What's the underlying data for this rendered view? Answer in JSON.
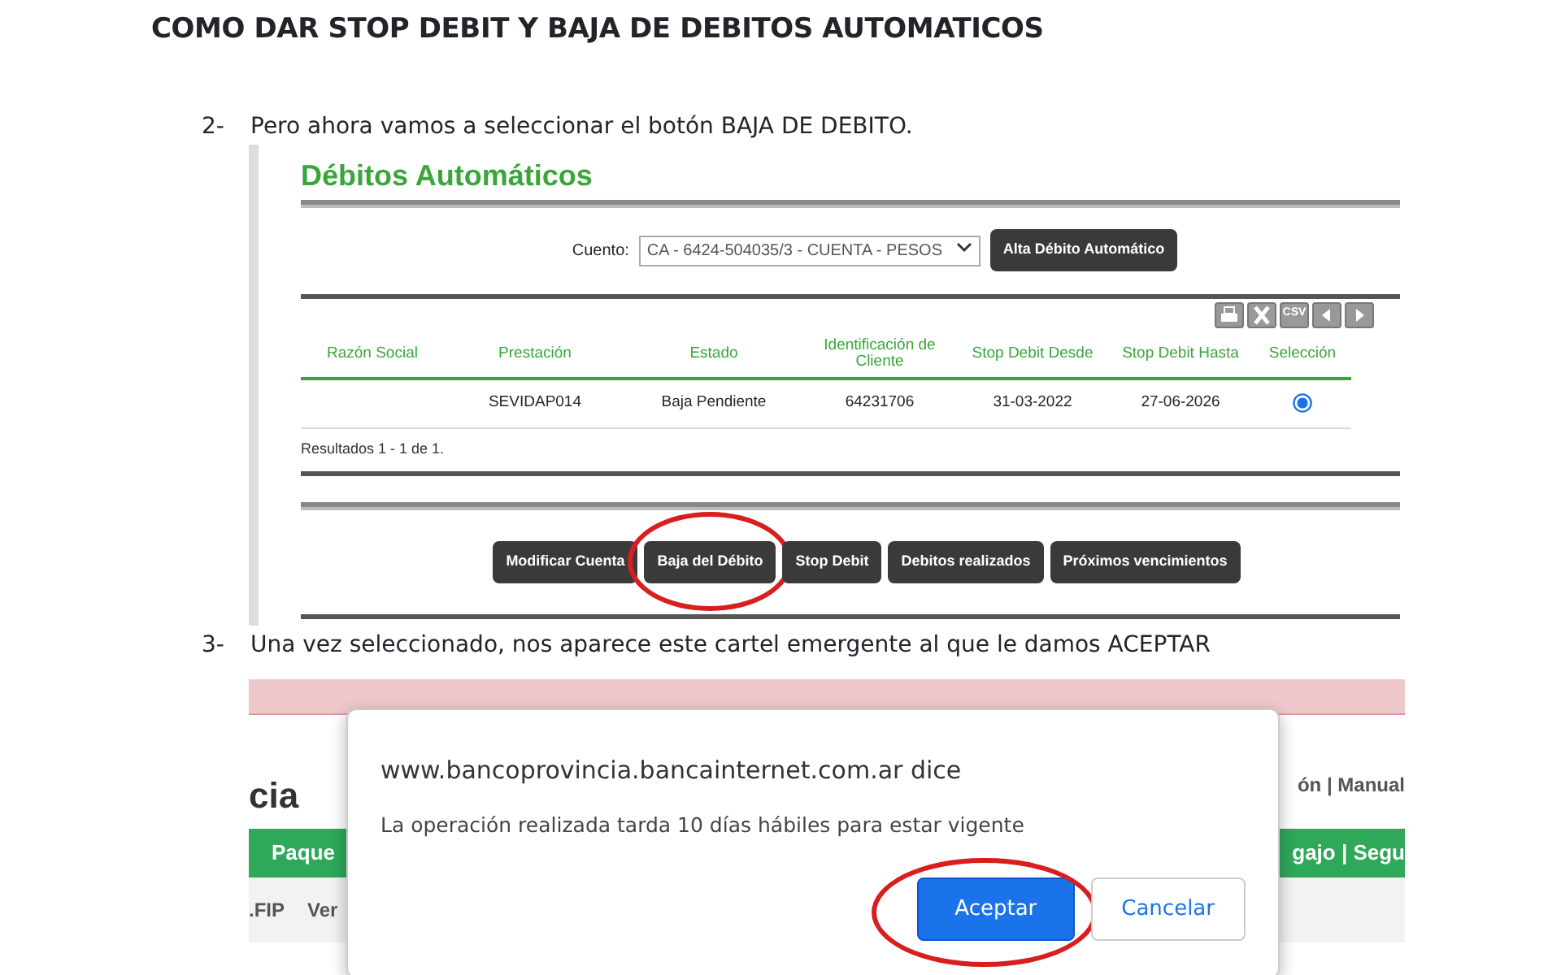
{
  "heading": "COMO DAR STOP DEBIT Y BAJA DE DEBITOS AUTOMATICOS",
  "steps": [
    {
      "number": "2-",
      "text": "Pero ahora vamos a seleccionar el botón BAJA DE DEBITO."
    },
    {
      "number": "3-",
      "text": "Una vez seleccionado, nos aparece este cartel emergente al que le damos ACEPTAR"
    }
  ],
  "debits_screen": {
    "title": "Débitos Automáticos",
    "account_label": "Cuento:",
    "account_value": "CA - 6424-504035/3 - CUENTA - PESOS",
    "add_button": "Alta Débito Automático",
    "export_buttons": [
      {
        "kind": "print"
      },
      {
        "kind": "excel"
      },
      {
        "kind": "csv",
        "label": "CSV"
      },
      {
        "kind": "prev"
      },
      {
        "kind": "next"
      }
    ],
    "table": {
      "columns": [
        "Razón Social",
        "Prestación",
        "Estado",
        "Identificación de Cliente",
        "Stop Debit Desde",
        "Stop Debit Hasta",
        "Selección"
      ],
      "rows": [
        {
          "prestacion": "SEVIDAP014",
          "estado": "Baja Pendiente",
          "identificacion": "64231706",
          "desde": "31-03-2022",
          "hasta": "27-06-2026",
          "selected": true
        }
      ]
    },
    "results": "Resultados 1 - 1 de 1.",
    "actions": [
      {
        "label": "Modificar Cuenta",
        "circled": false
      },
      {
        "label": "Baja del Débito",
        "circled": true
      },
      {
        "label": "Stop Debit",
        "circled": false
      },
      {
        "label": "Debitos realizados",
        "circled": false
      },
      {
        "label": "Próximos vencimientos",
        "circled": false
      }
    ]
  },
  "dialog_screen": {
    "background": {
      "logo_fragment": "cia",
      "links_fragment": "ón | Manual",
      "nav_left": "Paque",
      "nav_right": "gajo | Segu",
      "sub_nav": [
        ".FIP",
        "Ver"
      ]
    },
    "dialog": {
      "title": "www.bancoprovincia.bancainternet.com.ar dice",
      "message": "La operación realizada tarda 10 días hábiles para estar vigente",
      "buttons": [
        {
          "label": "Aceptar",
          "primary": true,
          "circled": true
        },
        {
          "label": "Cancelar",
          "primary": false,
          "circled": false
        }
      ]
    }
  }
}
